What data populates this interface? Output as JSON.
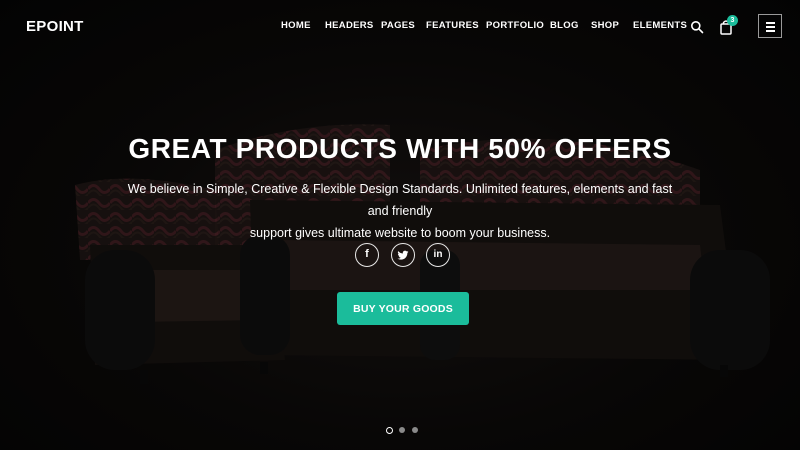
{
  "header": {
    "logo": "EPOINT",
    "nav": [
      "HOME",
      "HEADERS",
      "PAGES",
      "FEATURES",
      "PORTFOLIO",
      "BLOG",
      "SHOP",
      "ELEMENTS"
    ],
    "cart_count": "3"
  },
  "hero": {
    "title": "GREAT PRODUCTS WITH 50% OFFERS",
    "subtitle_line1": "We believe in Simple, Creative & Flexible Design Standards. Unlimited features, elements and fast and friendly",
    "subtitle_line2": "support gives ultimate website to boom your business.",
    "social": [
      {
        "icon": "facebook-icon",
        "glyph": "f"
      },
      {
        "icon": "twitter-icon",
        "glyph": "t"
      },
      {
        "icon": "linkedin-icon",
        "glyph": "in"
      }
    ],
    "cta_label": "BUY YOUR GOODS"
  },
  "slider": {
    "slide_count": 3,
    "active_slide": 1
  },
  "colors": {
    "accent": "#1bbc9b",
    "background": "#0b0b0b",
    "text": "#ffffff"
  }
}
